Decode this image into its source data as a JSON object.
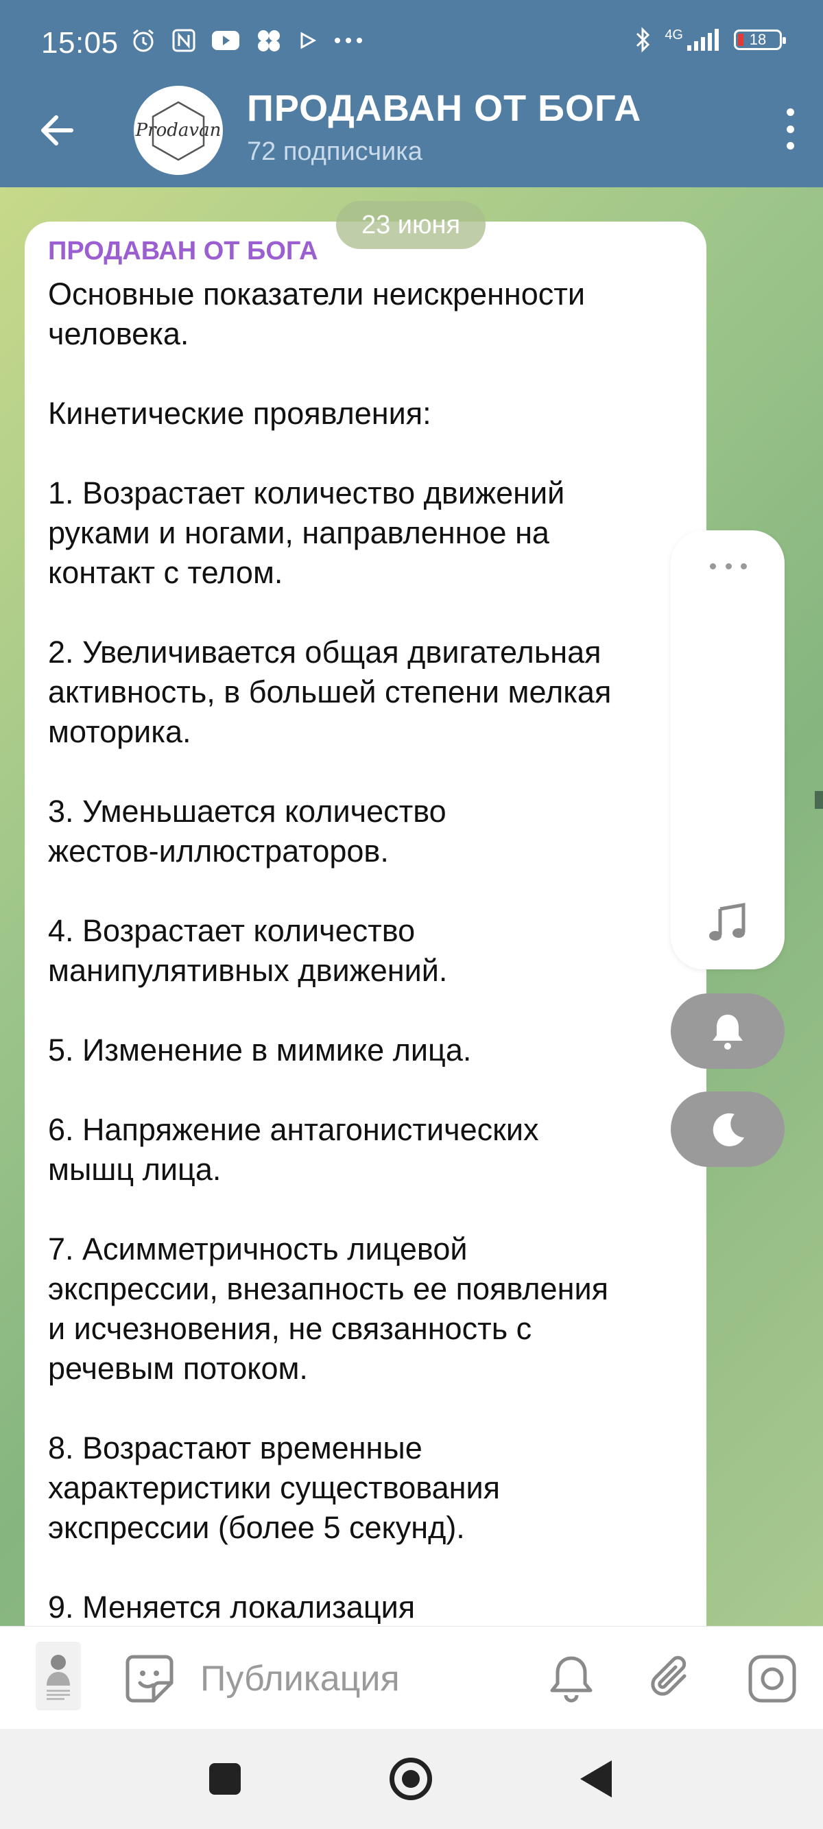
{
  "status_bar": {
    "time": "15:05",
    "network": "4G",
    "battery": "18",
    "icons": [
      "alarm-icon",
      "nfc-icon",
      "youtube-icon",
      "app-icon",
      "play-icon",
      "more-dots-icon",
      "bluetooth-icon",
      "signal-icon",
      "battery-icon"
    ]
  },
  "header": {
    "back_icon": "arrow-left-icon",
    "avatar_text": "Prodavan",
    "title": "ПРОДАВАН ОТ БОГА",
    "subtitle": "72 подписчика",
    "menu_icon": "kebab-menu-icon",
    "color": "#517da2"
  },
  "chat": {
    "date": "23 июня",
    "message": {
      "sender": "ПРОДАВАН ОТ БОГА",
      "sender_color": "#9b5fd1",
      "text": "Основные показатели неискренности\nчеловека.\n\nКинетические проявления:\n\n1. Возрастает количество движений\nруками и ногами, направленное на\nконтакт с телом.\n\n2. Увеличивается общая двигательная\nактивность, в большей степени мелкая\nмоторика.\n\n3. Уменьшается количество\nжестов-иллюстраторов.\n\n4. Возрастает количество\nманипулятивных движений.\n\n5. Изменение в мимике лица.\n\n6. Напряжение антагонистических\nмышц лица.\n\n7. Асимметричность лицевой\nэкспрессии, внезапность ее появления\nи исчезновения, не связанность с\nречевым потоком.\n\n8. Возрастают временные\nхарактеристики существования\nэкспрессии (более 5 секунд).\n\n9. Меняется локализация"
    },
    "floating_panel": {
      "icons": [
        "more-dots-icon",
        "music-note-icon"
      ]
    },
    "fab_icons": [
      "bell-icon",
      "moon-icon",
      "chevron-down-icon"
    ]
  },
  "input_bar": {
    "placeholder": "Публикация",
    "icons": [
      "sticker-icon",
      "bell-icon",
      "paperclip-icon",
      "camera-icon"
    ]
  },
  "nav_bar": {
    "icons": [
      "recents-icon",
      "home-icon",
      "back-icon"
    ]
  }
}
